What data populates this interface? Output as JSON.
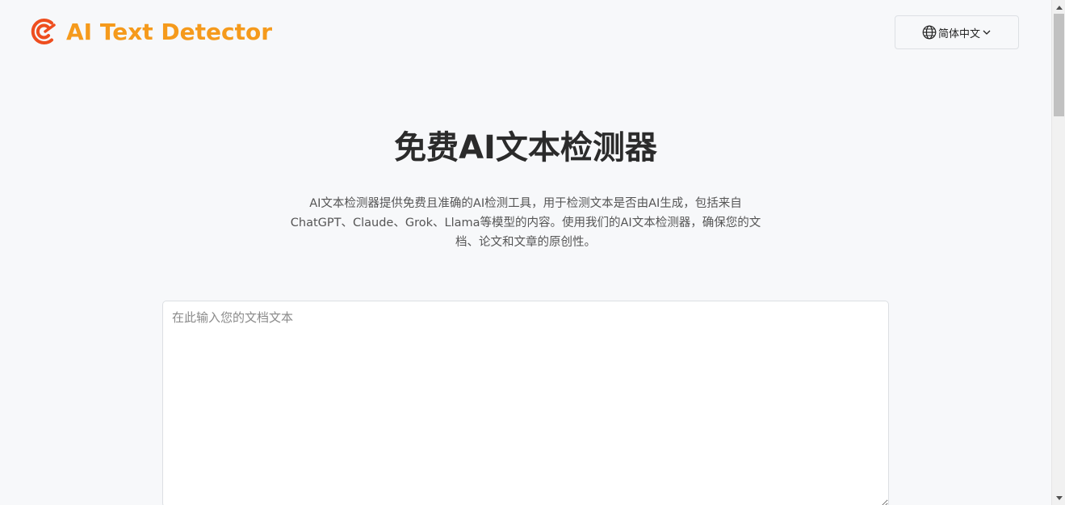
{
  "header": {
    "logo_text": "AI Text Detector",
    "logo_icon": "c-logo-icon",
    "brand_color": "#f59a1c",
    "logo_icon_color": "#ee4e1f",
    "language_label": "简体中文",
    "language_icon": "globe-icon",
    "dropdown_icon": "chevron-down-icon"
  },
  "hero": {
    "title": "免费AI文本检测器",
    "description": "AI文本检测器提供免费且准确的AI检测工具，用于检测文本是否由AI生成，包括来自ChatGPT、Claude、Grok、Llama等模型的内容。使用我们的AI文本检测器，确保您的文档、论文和文章的原创性。"
  },
  "editor": {
    "placeholder": "在此输入您的文档文本",
    "value": ""
  }
}
